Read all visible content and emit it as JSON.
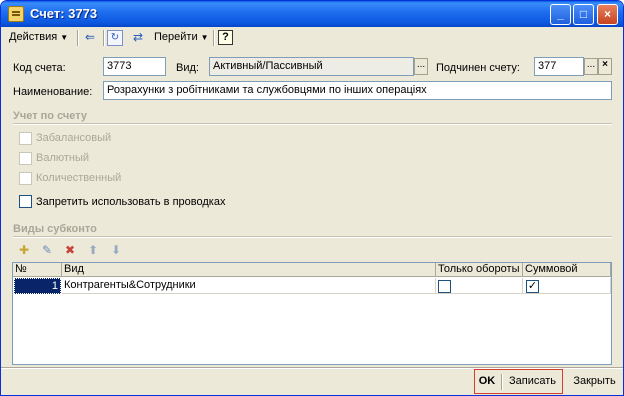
{
  "window": {
    "title": "Счет: 3773",
    "buttons": {
      "minimize": "_",
      "maximize": "□",
      "close": "×"
    }
  },
  "toolbar": {
    "actions_label": "Действия",
    "goto_label": "Перейти",
    "help_label": "?"
  },
  "form": {
    "code_label": "Код счета:",
    "code_value": "3773",
    "kind_label": "Вид:",
    "kind_value": "Активный/Пассивный",
    "parent_label": "Подчинен счету:",
    "parent_value": "377",
    "name_label": "Наименование:",
    "name_value": "Розрахунки з робітниками та службовцями по інших операціях",
    "select_button": "...",
    "clear_button": "×"
  },
  "accounting": {
    "title": "Учет по счету",
    "offbalance_label": "Забалансовый",
    "currency_label": "Валютный",
    "quantity_label": "Количественный",
    "forbid_label": "Запретить использовать в проводках"
  },
  "subconto": {
    "title": "Виды субконто",
    "columns": [
      "№",
      "Вид",
      "Только обороты",
      "Суммовой"
    ],
    "rows": [
      {
        "num": "1",
        "kind": "Контрагенты&Сотрудники",
        "turnover_only": false,
        "sum": true
      }
    ]
  },
  "footer": {
    "ok_label": "OK",
    "save_label": "Записать",
    "close_label": "Закрыть"
  }
}
